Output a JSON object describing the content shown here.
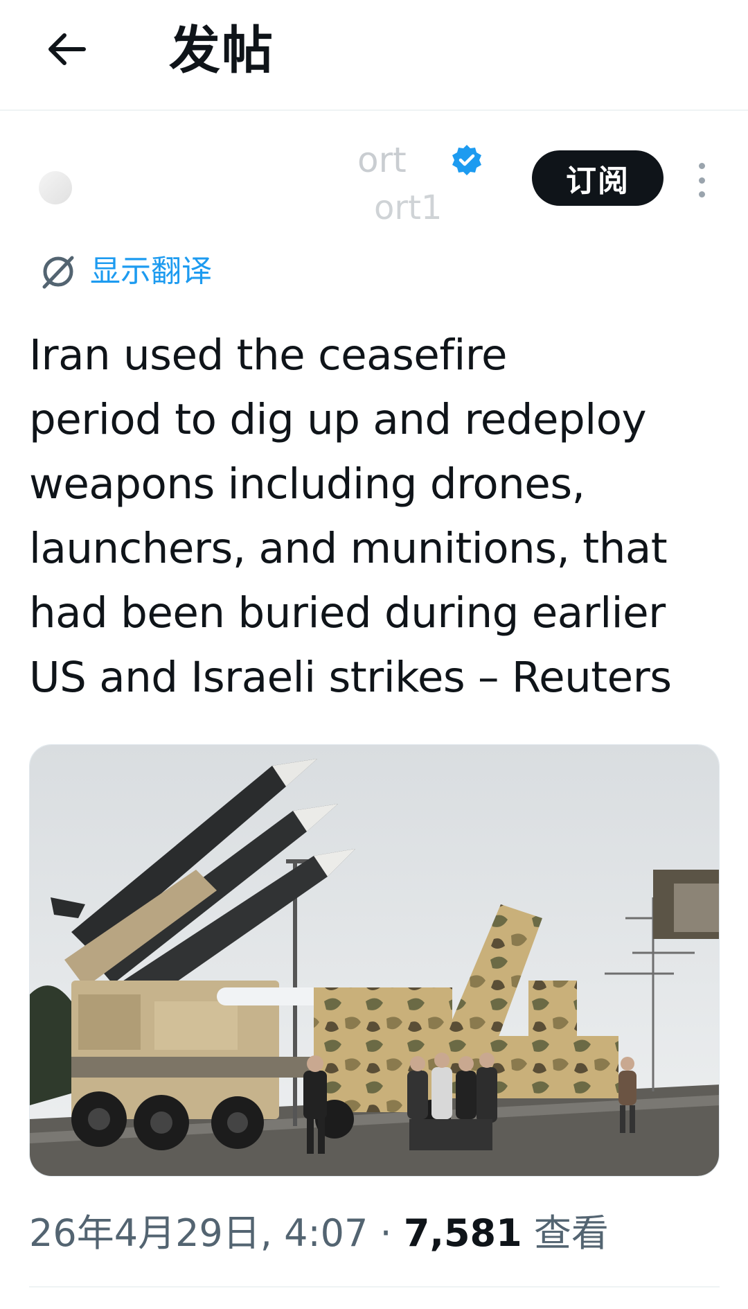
{
  "header": {
    "back_icon": "arrow-left-icon",
    "title": "发帖"
  },
  "author": {
    "display_name_fragment": "ort",
    "handle_fragment": "ort1",
    "verified_icon": "verified-badge-icon",
    "subscribe_label": "订阅",
    "more_icon": "more-vertical-icon"
  },
  "translate": {
    "icon": "translate-globe-icon",
    "label": "显示翻译"
  },
  "tweet": {
    "lines": [
      "Iran used the ceasefire",
      "period to dig up and redeploy",
      "weapons including drones,",
      "launchers, and munitions, that",
      "had been buried during earlier",
      "US and Israeli strikes – Reuters"
    ]
  },
  "media": {
    "kind": "photo"
  },
  "meta": {
    "timestamp": "26年4月29日, 4:07",
    "separator": " · ",
    "view_count": "7,581",
    "views_label": " 查看"
  },
  "colors": {
    "text": "#0f1419",
    "secondary": "#536471",
    "accent": "#1d9bf0",
    "button_bg": "#0f1419"
  }
}
